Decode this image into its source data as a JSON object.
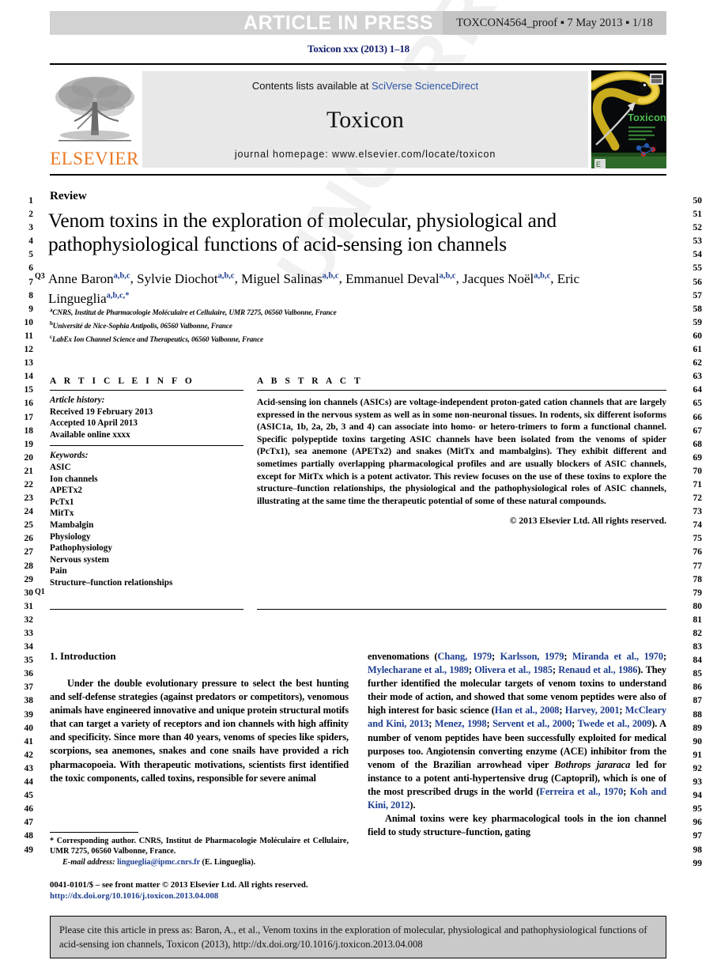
{
  "banner": {
    "article_in_press": "ARTICLE IN PRESS",
    "proof_info": "TOXCON4564_proof ▪ 7 May 2013 ▪ 1/18"
  },
  "running_head": "Toxicon xxx (2013) 1–18",
  "masthead": {
    "contents_prefix": "Contents lists available at ",
    "contents_link": "SciVerse ScienceDirect",
    "journal_title": "Toxicon",
    "homepage": "journal homepage: www.elsevier.com/locate/toxicon",
    "publisher_wordmark": "ELSEVIER",
    "cover_title": "Toxicon"
  },
  "article": {
    "kicker": "Review",
    "title": "Venom toxins in the exploration of molecular, physiological and pathophysiological functions of acid-sensing ion channels",
    "query_marks": {
      "q3": "Q3",
      "q1": "Q1"
    },
    "authors": [
      {
        "name": "Anne Baron",
        "marks": "a,b,c",
        "sep": ", "
      },
      {
        "name": "Sylvie Diochot",
        "marks": "a,b,c",
        "sep": ", "
      },
      {
        "name": "Miguel Salinas",
        "marks": "a,b,c",
        "sep": ", "
      },
      {
        "name": "Emmanuel Deval",
        "marks": "a,b,c",
        "sep": ", "
      },
      {
        "name": "Jacques Noël",
        "marks": "a,b,c",
        "sep": ", "
      },
      {
        "name": "Eric Lingueglia",
        "marks": "a,b,c,*",
        "sep": ""
      }
    ],
    "affiliations": [
      {
        "label": "a",
        "text": "CNRS, Institut de Pharmacologie Moléculaire et Cellulaire, UMR 7275, 06560 Valbonne, France"
      },
      {
        "label": "b",
        "text": "Université de Nice-Sophia Antipolis, 06560 Valbonne, France"
      },
      {
        "label": "c",
        "text": "LabEx Ion Channel Science and Therapeutics, 06560 Valbonne, France"
      }
    ]
  },
  "article_info": {
    "heading": "A R T I C L E  I N F O",
    "history_label": "Article history:",
    "history": [
      "Received 19 February 2013",
      "Accepted 10 April 2013",
      "Available online xxxx"
    ],
    "keywords_label": "Keywords:",
    "keywords": [
      "ASIC",
      "Ion channels",
      "APETx2",
      "PcTx1",
      "MitTx",
      "Mambalgin",
      "Physiology",
      "Pathophysiology",
      "Nervous system",
      "Pain",
      "Structure–function relationships"
    ]
  },
  "abstract": {
    "heading": "A B S T R A C T",
    "text": "Acid-sensing ion channels (ASICs) are voltage-independent proton-gated cation channels that are largely expressed in the nervous system as well as in some non-neuronal tissues. In rodents, six different isoforms (ASIC1a, 1b, 2a, 2b, 3 and 4) can associate into homo- or hetero-trimers to form a functional channel. Specific polypeptide toxins targeting ASIC channels have been isolated from the venoms of spider (PcTx1), sea anemone (APETx2) and snakes (MitTx and mambalgins). They exhibit different and sometimes partially overlapping pharmacological profiles and are usually blockers of ASIC channels, except for MitTx which is a potent activator. This review focuses on the use of these toxins to explore the structure–function relationships, the physiological and the pathophysiological roles of ASIC channels, illustrating at the same time the therapeutic potential of some of these natural compounds.",
    "copyright": "© 2013 Elsevier Ltd. All rights reserved."
  },
  "introduction": {
    "heading": "1. Introduction",
    "left_paragraph": "Under the double evolutionary pressure to select the best hunting and self-defense strategies (against predators or competitors), venomous animals have engineered innovative and unique protein structural motifs that can target a variety of receptors and ion channels with high affinity and specificity. Since more than 40 years, venoms of species like spiders, scorpions, sea anemones, snakes and cone snails have provided a rich pharmacopoeia. With therapeutic motivations, scientists first identified the toxic components, called toxins, responsible for severe animal",
    "right_paragraph_1": "envenomations (Chang, 1979; Karlsson, 1979; Miranda et al., 1970; Mylecharane et al., 1989; Olivera et al., 1985; Renaud et al., 1986). They further identified the molecular targets of venom toxins to understand their mode of action, and showed that some venom peptides were also of high interest for basic science (Han et al., 2008; Harvey, 2001; McCleary and Kini, 2013; Menez, 1998; Servent et al., 2000; Twede et al., 2009). A number of venom peptides have been successfully exploited for medical purposes too. Angiotensin converting enzyme (ACE) inhibitor from the venom of the Brazilian arrowhead viper Bothrops jararaca led for instance to a potent anti-hypertensive drug (Captopril), which is one of the most prescribed drugs in the world (Ferreira et al., 1970; Koh and Kini, 2012).",
    "right_paragraph_2": "Animal toxins were key pharmacological tools in the ion channel field to study structure–function, gating"
  },
  "footnote": {
    "corresponding": "* Corresponding author. CNRS, Institut de Pharmacologie Moléculaire et Cellulaire, UMR 7275, 06560 Valbonne, France.",
    "email_label": "E-mail address:",
    "email": "lingueglia@ipmc.cnrs.fr",
    "email_owner": "(E. Lingueglia)."
  },
  "imprint": {
    "issn_line": "0041-0101/$ – see front matter © 2013 Elsevier Ltd. All rights reserved.",
    "doi": "http://dx.doi.org/10.1016/j.toxicon.2013.04.008"
  },
  "cite_box": "Please cite this article in press as: Baron, A., et al., Venom toxins in the exploration of molecular, physiological and pathophysiological functions of acid-sensing ion channels, Toxicon (2013), http://dx.doi.org/10.1016/j.toxicon.2013.04.008",
  "line_numbers": {
    "left_start": 1,
    "left_end": 49,
    "right_start": 50,
    "right_end": 99
  },
  "watermark": "UNCORRECTED PROOF",
  "colors": {
    "link_blue": "#1d3d8f",
    "sciencedirect_blue": "#2b54a6",
    "elsevier_orange": "#e87722",
    "banner_gray": "#d2d2d2",
    "proof_gray": "#c4c4c4",
    "masthead_gray": "#e8e8e8",
    "cite_gray": "#c9c9c9"
  }
}
